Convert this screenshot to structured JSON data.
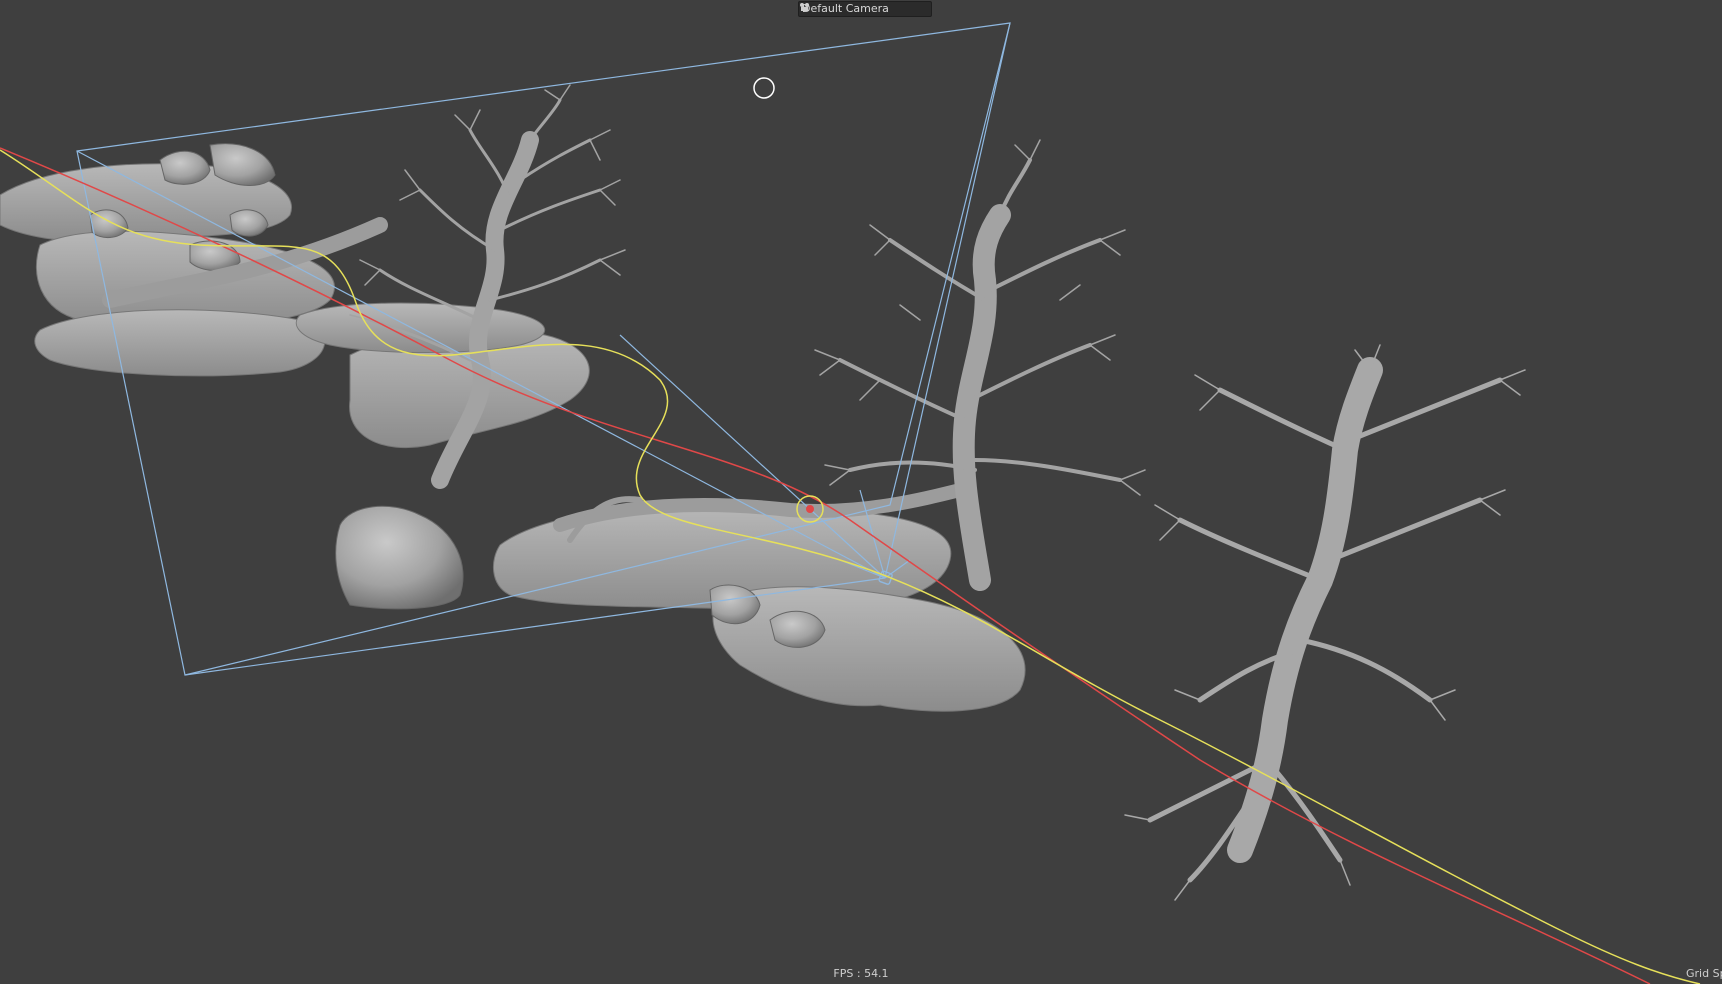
{
  "viewport": {
    "camera_selector": {
      "label": "Default Camera",
      "icon": "camera-icon"
    },
    "fps_readout": "FPS : 54.1",
    "grid_label": "Grid Sp",
    "colors": {
      "background": "#3f3f3f",
      "frustum": "#8fb8e0",
      "spline_yellow": "#e6e05a",
      "spline_red": "#e04848",
      "geometry": "#a8a8a8"
    }
  }
}
